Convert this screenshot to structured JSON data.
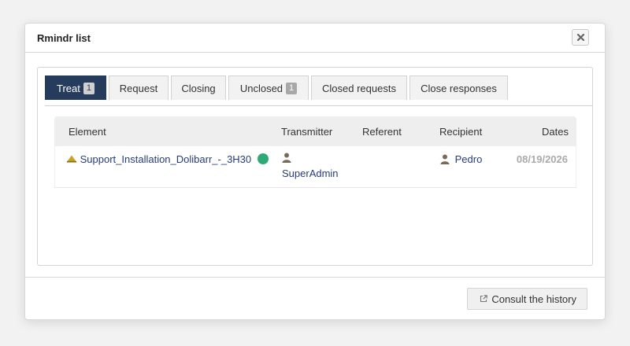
{
  "dialog": {
    "title": "Rmindr list",
    "close_glyph": "✖"
  },
  "tabs": [
    {
      "label": "Treat",
      "badge": "1",
      "active": true
    },
    {
      "label": "Request"
    },
    {
      "label": "Closing"
    },
    {
      "label": "Unclosed",
      "badge": "1"
    },
    {
      "label": "Closed requests"
    },
    {
      "label": "Close responses"
    }
  ],
  "table": {
    "headers": [
      "Element",
      "Transmitter",
      "Referent",
      "Recipient",
      "Dates"
    ],
    "rows": [
      {
        "element": "Support_Installation_Dolibarr_-_3H30",
        "element_icon": "warning-triangle-icon",
        "status_color": "#2eaa77",
        "transmitter": "SuperAdmin",
        "transmitter_icon": "user-icon",
        "referent": "",
        "recipient": "Pedro",
        "recipient_icon": "user-icon",
        "date": "08/19/2026"
      }
    ]
  },
  "footer": {
    "history_button": "Consult the history",
    "history_icon": "external-link-icon"
  },
  "colors": {
    "active_tab": "#263c5c",
    "link": "#263c7a",
    "status_dot": "#2eaa77",
    "warning_icon": "#c9a227"
  }
}
